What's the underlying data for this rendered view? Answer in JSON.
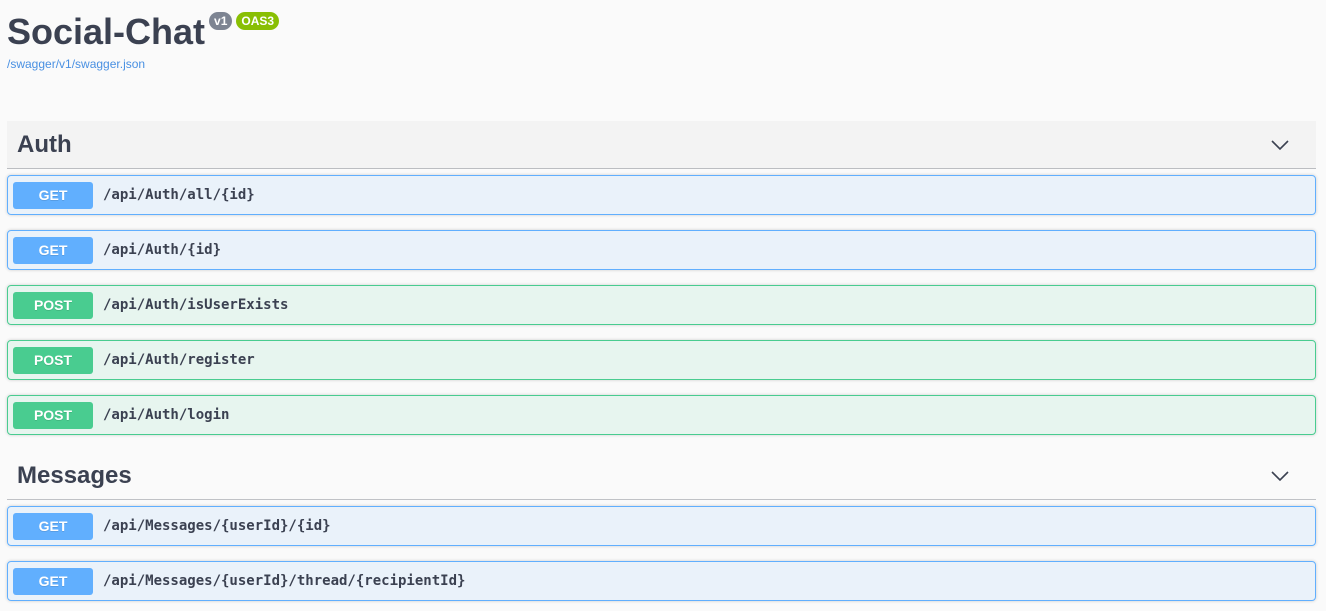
{
  "info": {
    "title": "Social-Chat",
    "version_badge": "v1",
    "oas_badge": "OAS3",
    "spec_link": "/swagger/v1/swagger.json"
  },
  "icons": {
    "collapse": "chevron-down-icon"
  },
  "colors": {
    "get": "#61affe",
    "post": "#49cc90",
    "title": "#3b4151",
    "link": "#4990e2"
  },
  "sections": [
    {
      "name": "Auth",
      "operations": [
        {
          "method": "GET",
          "path": "/api/Auth/all/{id}"
        },
        {
          "method": "GET",
          "path": "/api/Auth/{id}"
        },
        {
          "method": "POST",
          "path": "/api/Auth/isUserExists"
        },
        {
          "method": "POST",
          "path": "/api/Auth/register"
        },
        {
          "method": "POST",
          "path": "/api/Auth/login"
        }
      ]
    },
    {
      "name": "Messages",
      "operations": [
        {
          "method": "GET",
          "path": "/api/Messages/{userId}/{id}"
        },
        {
          "method": "GET",
          "path": "/api/Messages/{userId}/thread/{recipientId}"
        }
      ]
    }
  ]
}
